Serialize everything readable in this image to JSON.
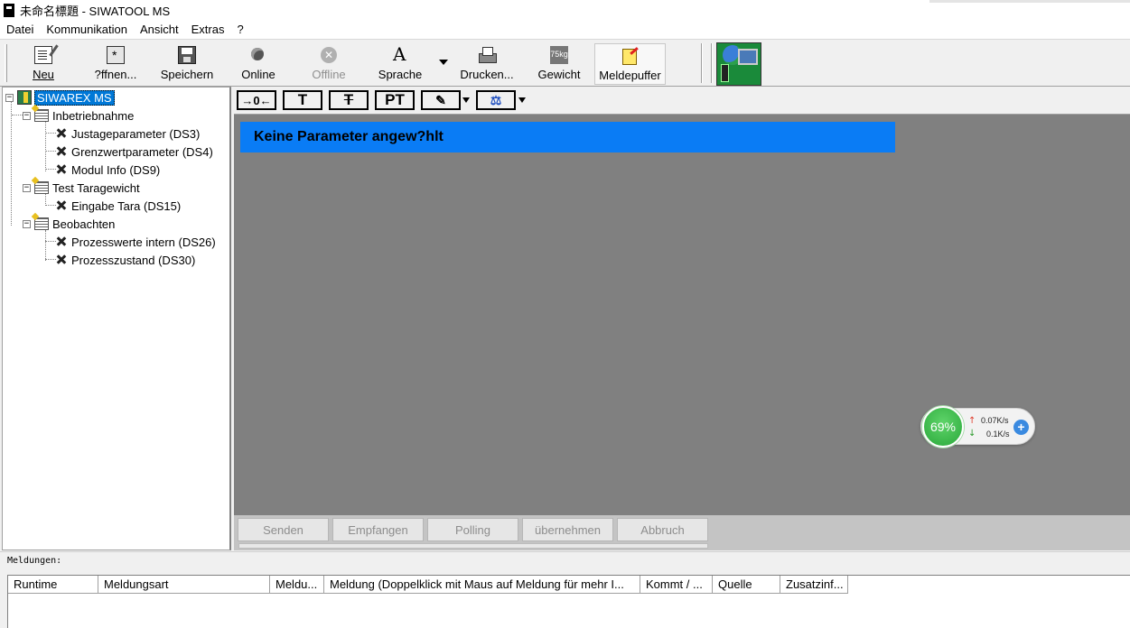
{
  "window": {
    "title": "未命名標題 - SIWATOOL MS"
  },
  "menu": [
    "Datei",
    "Kommunikation",
    "Ansicht",
    "Extras",
    "?"
  ],
  "toolbar": {
    "new_label": "Neu",
    "open_label": "?ffnen...",
    "save_label": "Speichern",
    "online_label": "Online",
    "offline_label": "Offline",
    "language_label": "Sprache",
    "print_label": "Drucken...",
    "weight_label": "Gewicht",
    "weight_icon_text": "75kg",
    "messages_label": "Meldepuffer"
  },
  "tree": {
    "root": "SIWAREX MS",
    "groups": [
      {
        "label": "Inbetriebnahme",
        "items": [
          "Justageparameter (DS3)",
          "Grenzwertparameter (DS4)",
          "Modul Info (DS9)"
        ]
      },
      {
        "label": "Test Taragewicht",
        "items": [
          "Eingabe Tara (DS15)"
        ]
      },
      {
        "label": "Beobachten",
        "items": [
          "Prozesswerte intern (DS26)",
          "Prozesszustand (DS30)"
        ]
      }
    ]
  },
  "param_toolbar": {
    "t_label": "T",
    "pt_label": "PT"
  },
  "banner": {
    "text": "Keine Parameter angew?hlt",
    "color": "#0a7cf5"
  },
  "actions": [
    "Senden",
    "Empfangen",
    "Polling",
    "übernehmen",
    "Abbruch"
  ],
  "network_widget": {
    "percent": "69%",
    "up_speed": "0.07K/s",
    "down_speed": "0.1K/s"
  },
  "messages": {
    "label": "Meldungen:",
    "columns": [
      "Runtime",
      "Meldungsart",
      "Meldu...",
      "Meldung (Doppelklick mit Maus auf Meldung für mehr I...",
      "Kommt / ...",
      "Quelle",
      "Zusatzinf..."
    ]
  }
}
